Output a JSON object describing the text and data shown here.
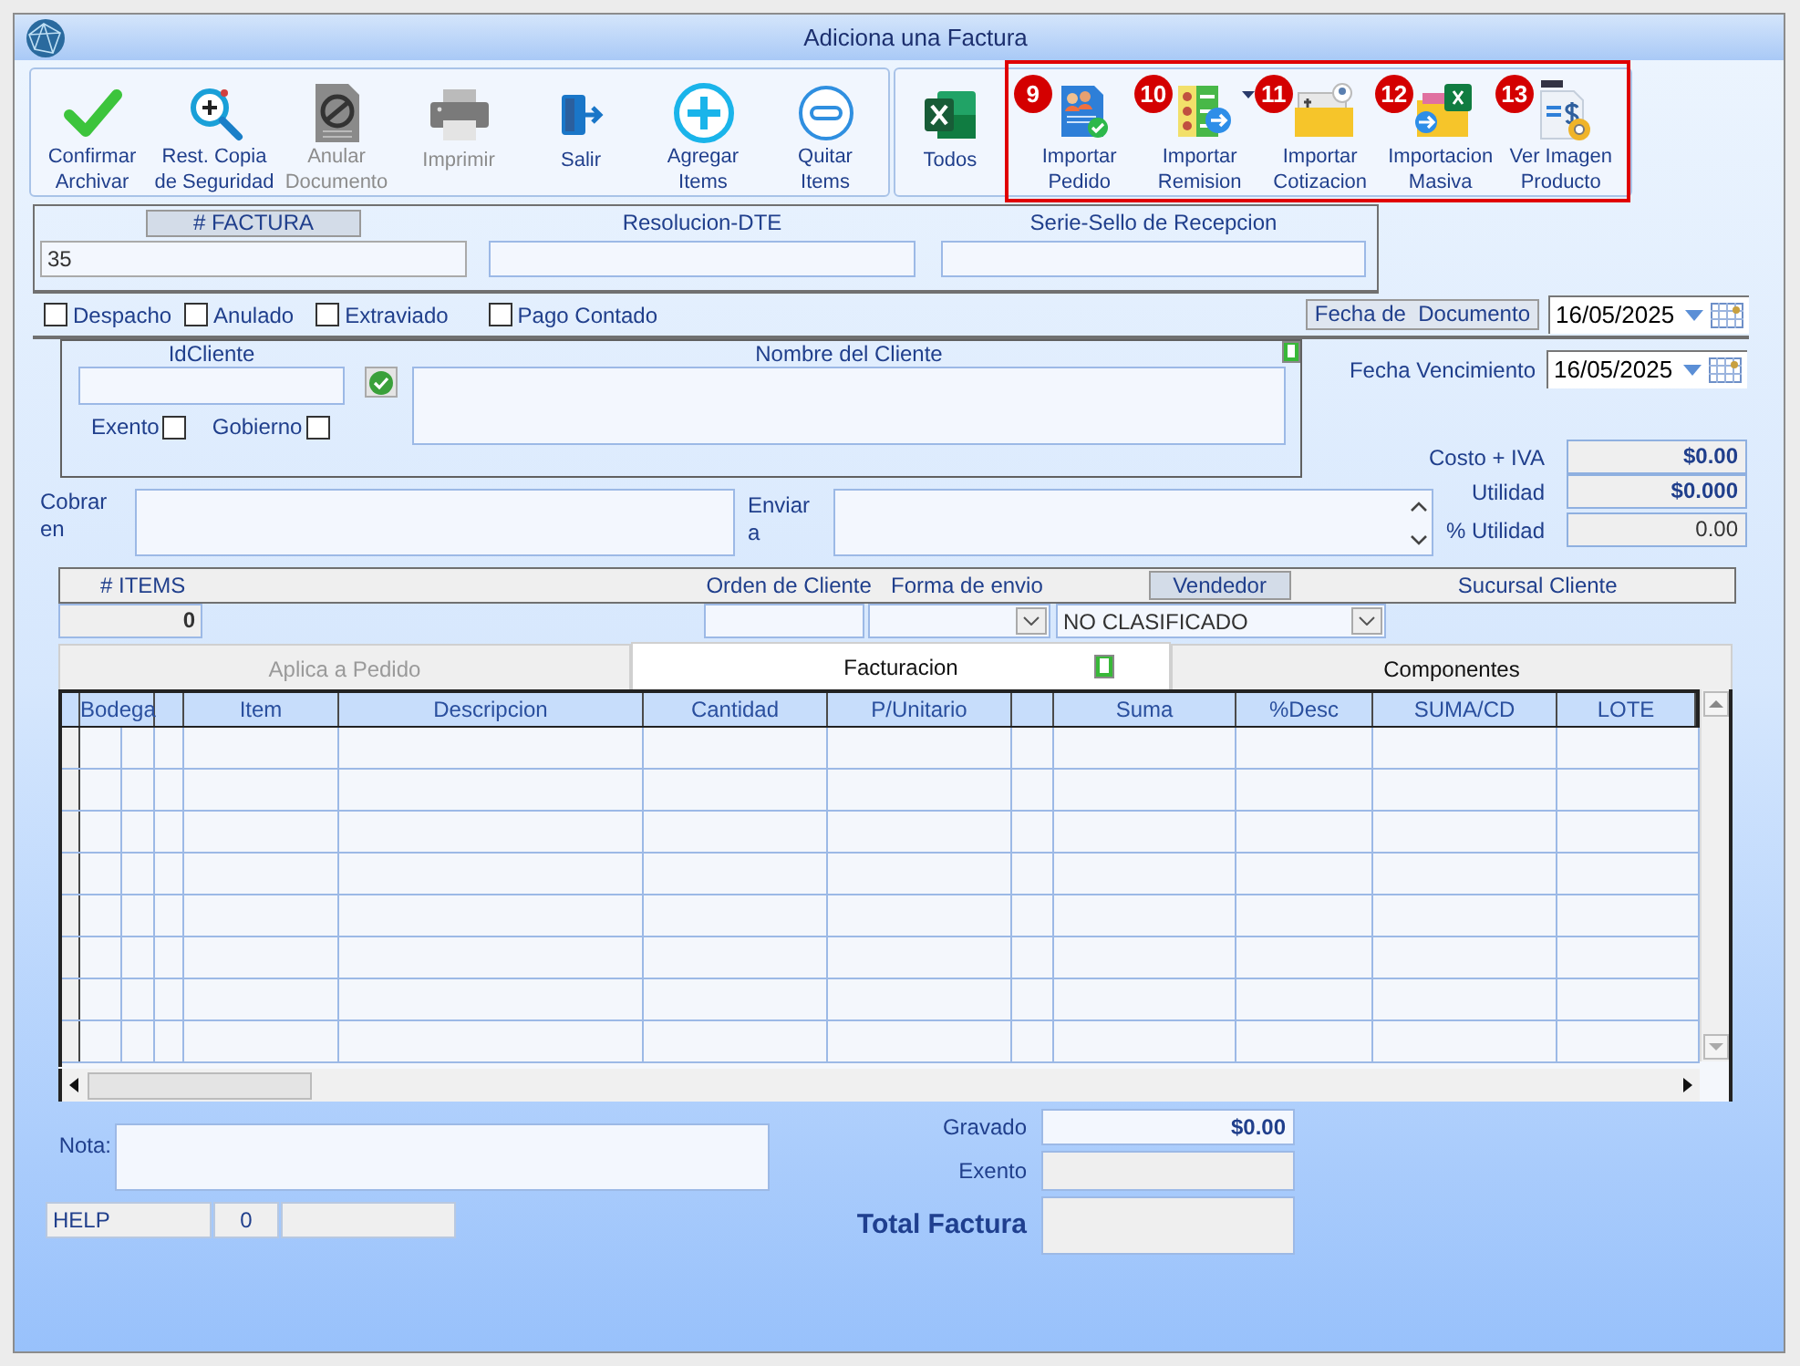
{
  "window": {
    "title": "Adiciona una Factura"
  },
  "toolbar": [
    {
      "label": "Confirmar\nArchivar",
      "disabled": false
    },
    {
      "label": "Rest. Copia\nde Seguridad",
      "disabled": false
    },
    {
      "label": "Anular\nDocumento",
      "disabled": true
    },
    {
      "label": "Imprimir",
      "disabled": true
    },
    {
      "label": "Salir",
      "disabled": false
    },
    {
      "label": "Agregar\nItems",
      "disabled": false
    },
    {
      "label": "Quitar\nItems",
      "disabled": false
    }
  ],
  "export_button": {
    "label": "Todos"
  },
  "import_buttons": [
    {
      "badge": "9",
      "label": "Importar\nPedido"
    },
    {
      "badge": "10",
      "label": "Importar\nRemision"
    },
    {
      "badge": "11",
      "label": "Importar\nCotizacion"
    },
    {
      "badge": "12",
      "label": "Importacion\nMasiva"
    },
    {
      "badge": "13",
      "label": "Ver Imagen\nProducto"
    }
  ],
  "factura": {
    "numero_label": "# FACTURA",
    "numero": "35",
    "resolucion_label": "Resolucion-DTE",
    "serie_label": "Serie-Sello de Recepcion"
  },
  "flags": [
    {
      "label": "Despacho",
      "checked": false
    },
    {
      "label": "Anulado",
      "checked": false
    },
    {
      "label": "Extraviado",
      "checked": false
    },
    {
      "label": "Pago Contado",
      "checked": false
    }
  ],
  "fecha_documento": {
    "label": "Fecha de  Documento",
    "value": "16/05/2025"
  },
  "cliente": {
    "id_label": "IdCliente",
    "nombre_label": "Nombre del Cliente",
    "exento": {
      "label": "Exento",
      "checked": false
    },
    "gobierno": {
      "label": "Gobierno",
      "checked": false
    }
  },
  "fecha_vencimiento": {
    "label": "Fecha Vencimiento",
    "value": "16/05/2025"
  },
  "costos": [
    {
      "label": "Costo + IVA",
      "value": "$0.00",
      "bold": true
    },
    {
      "label": "Utilidad",
      "value": "$0.000",
      "bold": true
    },
    {
      "label": "% Utilidad",
      "value": "0.00",
      "bold": false
    }
  ],
  "cobrar_label": "Cobrar en",
  "enviar_label": "Enviar a",
  "items_bar": {
    "items_label": "# ITEMS",
    "items_count": "0",
    "orden_label": "Orden de Cliente",
    "forma_label": "Forma de envio",
    "vendedor_label": "Vendedor",
    "vendedor_value": "NO CLASIFICADO",
    "sucursal_label": "Sucursal Cliente"
  },
  "tabs": [
    {
      "label": "Aplica a Pedido",
      "selected": false,
      "disabled": true
    },
    {
      "label": "Facturacion",
      "selected": true,
      "disabled": false
    },
    {
      "label": "Componentes",
      "selected": false,
      "disabled": false
    }
  ],
  "grid": {
    "columns": [
      "Bodega",
      "Item",
      "Descripcion",
      "Cantidad",
      "P/Unitario",
      "Suma",
      "%Desc",
      "SUMA/CD",
      "LOTE"
    ]
  },
  "footer": {
    "nota_label": "Nota:",
    "status": [
      "HELP",
      "0"
    ],
    "gravado": {
      "label": "Gravado",
      "value": "$0.00"
    },
    "exento_label": "Exento",
    "total_label": "Total Factura"
  }
}
